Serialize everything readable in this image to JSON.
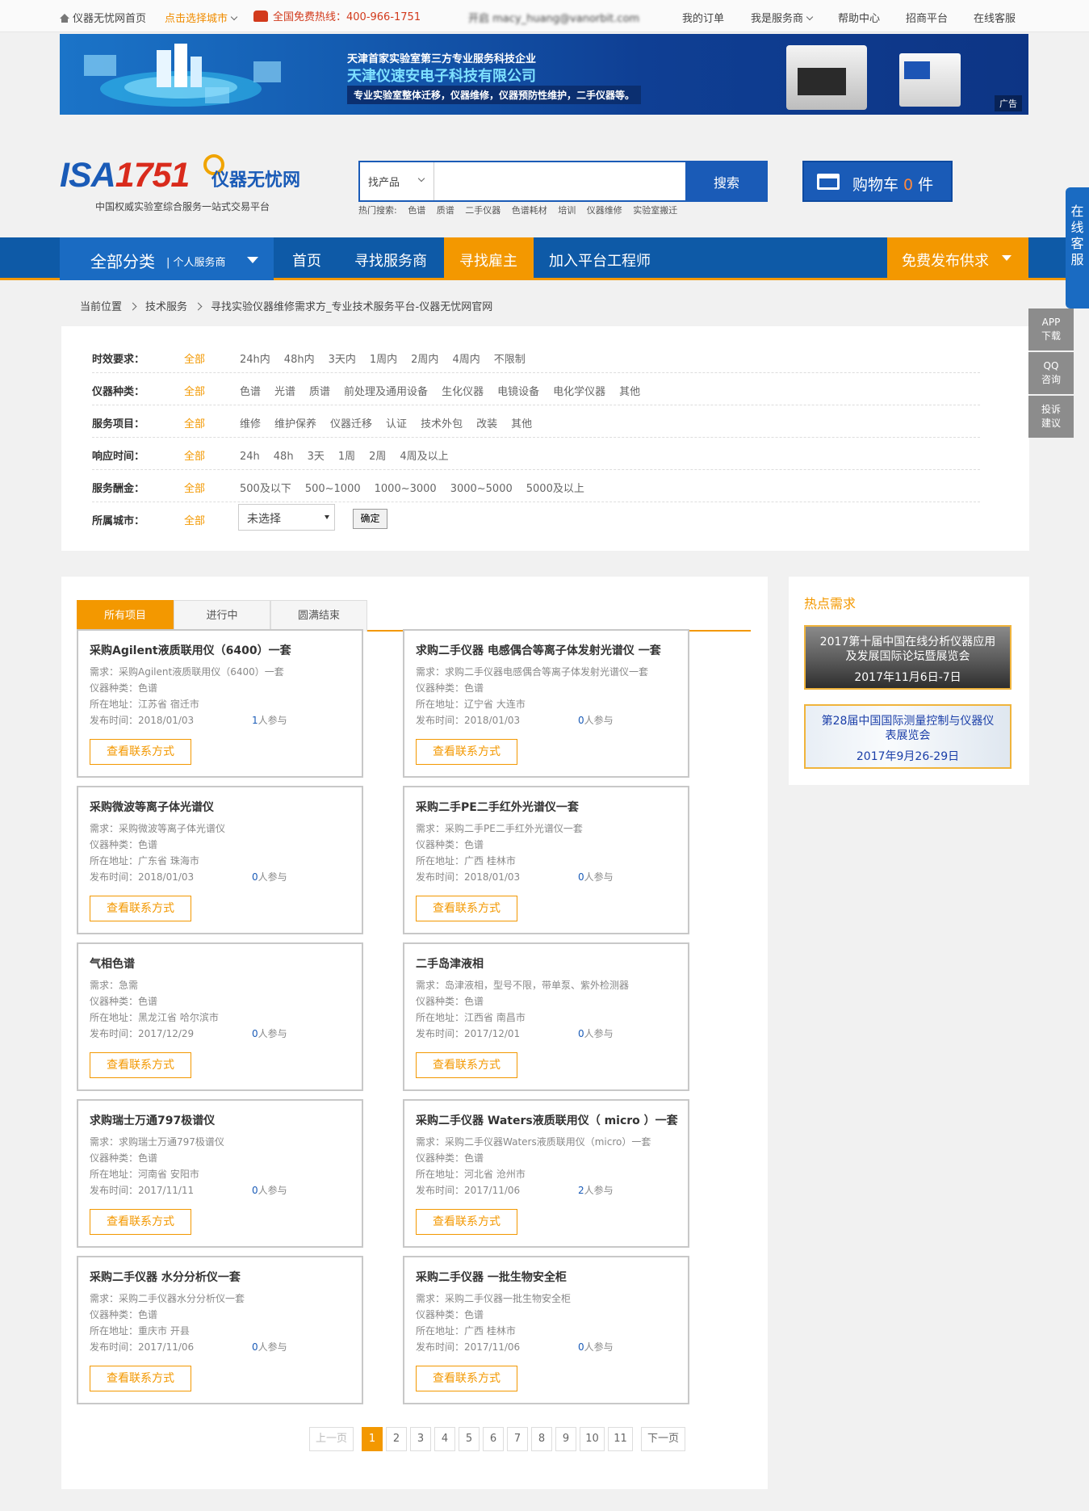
{
  "topbar": {
    "home": "仪器无忧网首页",
    "city": "点击选择城市",
    "hotline": "全国免费热线：400-966-1751",
    "user": "开启  macy_huang@vanorbit.com",
    "my_orders": "我的订单",
    "i_am_provider": "我是服务商",
    "help": "帮助中心",
    "merchants": "招商平台",
    "online_service": "在线客服"
  },
  "banner": {
    "line1": "天津首家实验室第三方专业服务科技企业",
    "line2": "天津仪速安电子科技有限公司",
    "line3": "专业实验室整体迁移，仪器维修，仪器预防性维护，二手仪器等。",
    "ad": "广告"
  },
  "logo": {
    "isa": "ISA",
    "num": "1751",
    "cn": "仪器无忧网",
    "sub": "中国权威实验室综合服务一站式交易平台"
  },
  "search": {
    "select": "找产品",
    "placeholder": "",
    "button": "搜索",
    "hot_label": "热门搜索:",
    "hot": [
      "色谱",
      "质谱",
      "二手仪器",
      "色谱耗材",
      "培训",
      "仪器维修",
      "实验室搬迁"
    ]
  },
  "cart": {
    "label": "购物车",
    "count": "0",
    "unit": "件"
  },
  "nav": {
    "all": "全部分类",
    "personal": "| 个人服务商",
    "links": [
      "首页",
      "寻找服务商",
      "寻找雇主",
      "加入平台工程师"
    ],
    "publish": "免费发布供求"
  },
  "breadcrumb": [
    "当前位置",
    "技术服务",
    "寻找实验仪器维修需求方_专业技术服务平台-仪器无忧网官网"
  ],
  "filters": [
    {
      "label": "时效要求：",
      "all": "全部",
      "options": [
        "24h内",
        "48h内",
        "3天内",
        "1周内",
        "2周内",
        "4周内",
        "不限制"
      ]
    },
    {
      "label": "仪器种类：",
      "all": "全部",
      "options": [
        "色谱",
        "光谱",
        "质谱",
        "前处理及通用设备",
        "生化仪器",
        "电镜设备",
        "电化学仪器",
        "其他"
      ]
    },
    {
      "label": "服务项目：",
      "all": "全部",
      "options": [
        "维修",
        "维护保养",
        "仪器迁移",
        "认证",
        "技术外包",
        "改装",
        "其他"
      ]
    },
    {
      "label": "响应时间：",
      "all": "全部",
      "options": [
        "24h",
        "48h",
        "3天",
        "1周",
        "2周",
        "4周及以上"
      ]
    },
    {
      "label": "服务酬金：",
      "all": "全部",
      "options": [
        "500及以下",
        "500~1000",
        "1000~3000",
        "3000~5000",
        "5000及以上"
      ]
    },
    {
      "label": "所属城市：",
      "all": "全部",
      "options": []
    }
  ],
  "city_select": "未选择",
  "confirm": "确定",
  "tabs": [
    "所有项目",
    "进行中",
    "圆满结束"
  ],
  "cards": [
    {
      "title": "采购Agilent液质联用仪（6400）一套",
      "need": "需求：采购Agilent液质联用仪（6400）一套",
      "kind": "仪器种类：色谱",
      "addr": "所在地址：江苏省 宿迁市",
      "date": "发布时间：2018/01/03",
      "count": "1",
      "join": "人参与"
    },
    {
      "title": "求购二手仪器 电感偶合等离子体发射光谱仪 一套",
      "need": "需求：求购二手仪器电感偶合等离子体发射光谱仪一套",
      "kind": "仪器种类：色谱",
      "addr": "所在地址：辽宁省 大连市",
      "date": "发布时间：2018/01/03",
      "count": "0",
      "join": "人参与"
    },
    {
      "title": "采购微波等离子体光谱仪",
      "need": "需求：采购微波等离子体光谱仪",
      "kind": "仪器种类：色谱",
      "addr": "所在地址：广东省 珠海市",
      "date": "发布时间：2018/01/03",
      "count": "0",
      "join": "人参与"
    },
    {
      "title": "采购二手PE二手红外光谱仪一套",
      "need": "需求：采购二手PE二手红外光谱仪一套",
      "kind": "仪器种类：色谱",
      "addr": "所在地址：广西 桂林市",
      "date": "发布时间：2018/01/03",
      "count": "0",
      "join": "人参与"
    },
    {
      "title": "气相色谱",
      "need": "需求：急需",
      "kind": "仪器种类：色谱",
      "addr": "所在地址：黑龙江省 哈尔滨市",
      "date": "发布时间：2017/12/29",
      "count": "0",
      "join": "人参与"
    },
    {
      "title": "二手岛津液相",
      "need": "需求：岛津液相，型号不限，带单泵、紫外检测器",
      "kind": "仪器种类：色谱",
      "addr": "所在地址：江西省 南昌市",
      "date": "发布时间：2017/12/01",
      "count": "0",
      "join": "人参与"
    },
    {
      "title": "求购瑞士万通797极谱仪",
      "need": "需求：求购瑞士万通797极谱仪",
      "kind": "仪器种类：色谱",
      "addr": "所在地址：河南省 安阳市",
      "date": "发布时间：2017/11/11",
      "count": "0",
      "join": "人参与"
    },
    {
      "title": "采购二手仪器 Waters液质联用仪（ micro ）一套",
      "need": "需求：采购二手仪器Waters液质联用仪（micro）一套",
      "kind": "仪器种类：色谱",
      "addr": "所在地址：河北省 沧州市",
      "date": "发布时间：2017/11/06",
      "count": "2",
      "join": "人参与"
    },
    {
      "title": "采购二手仪器 水分分析仪一套",
      "need": "需求：采购二手仪器水分分析仪一套",
      "kind": "仪器种类：色谱",
      "addr": "所在地址：重庆市 开县",
      "date": "发布时间：2017/11/06",
      "count": "0",
      "join": "人参与"
    },
    {
      "title": "采购二手仪器 一批生物安全柜",
      "need": "需求：采购二手仪器一批生物安全柜",
      "kind": "仪器种类：色谱",
      "addr": "所在地址：广西 桂林市",
      "date": "发布时间：2017/11/06",
      "count": "0",
      "join": "人参与"
    }
  ],
  "card_button": "查看联系方式",
  "pager": {
    "prev": "上一页",
    "pages": [
      "1",
      "2",
      "3",
      "4",
      "5",
      "6",
      "7",
      "8",
      "9",
      "10",
      "11"
    ],
    "next": "下一页",
    "current": "1"
  },
  "hot_demand": {
    "title": "热点需求",
    "items": [
      {
        "text": "2017第十届中国在线分析仪器应用及发展国际论坛暨展览会",
        "date": "2017年11月6日-7日"
      },
      {
        "text": "第28届中国国际测量控制与仪器仪表展览会",
        "date": "2017年9月26-29日"
      }
    ]
  },
  "side": {
    "kefu": "在线客服",
    "app": [
      "APP",
      "下载"
    ],
    "qq": [
      "QQ",
      "咨询"
    ],
    "complaint": [
      "投诉",
      "建议"
    ]
  },
  "colors": {
    "brand_blue": "#0e5aa7",
    "accent_orange": "#f39800"
  }
}
